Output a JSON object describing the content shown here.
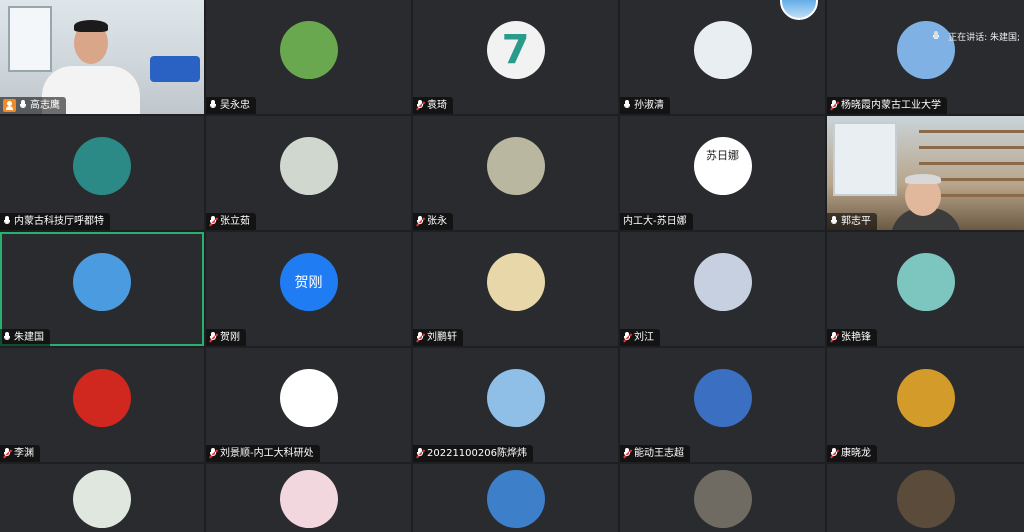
{
  "speaking": {
    "label": "正在讲话: 朱建国;"
  },
  "tiles": [
    {
      "name": "高志鹰",
      "mic": "on",
      "host": true,
      "avatar": "video-office"
    },
    {
      "name": "吴永忠",
      "mic": "on",
      "avatar": "grassland",
      "color": "#6aa84f"
    },
    {
      "name": "袁琦",
      "mic": "muted",
      "avatar": "number-seven",
      "color": "#f2f2f2"
    },
    {
      "name": "孙淑清",
      "mic": "on",
      "avatar": "blossom",
      "color": "#e9eef2"
    },
    {
      "name": "杨晓霞内蒙古工业大学",
      "mic": "muted",
      "avatar": "sky",
      "color": "#7fb1e4"
    },
    {
      "name": "内蒙古科技厅呼都特",
      "mic": "on",
      "avatar": "cartoon-girl",
      "color": "#2c8a86"
    },
    {
      "name": "张立茹",
      "mic": "muted",
      "avatar": "flowers",
      "color": "#cfd7cf"
    },
    {
      "name": "张永",
      "mic": "muted",
      "avatar": "sculpture",
      "color": "#b9b7a0"
    },
    {
      "name": "内工大-苏日娜",
      "mic": "none",
      "avatar": "sketch-girl",
      "color": "#ffffff",
      "avatar_text": "苏日娜"
    },
    {
      "name": "郭志平",
      "mic": "on",
      "avatar": "video-study"
    },
    {
      "name": "朱建国",
      "mic": "on",
      "active": true,
      "avatar": "lake",
      "color": "#4b9be0"
    },
    {
      "name": "贺刚",
      "mic": "muted",
      "avatar": "text-avatar",
      "color": "#1f7cf2",
      "avatar_text": "贺刚"
    },
    {
      "name": "刘鹏轩",
      "mic": "muted",
      "avatar": "pikachu",
      "color": "#e8d7a8"
    },
    {
      "name": "刘江",
      "mic": "muted",
      "avatar": "family-photo",
      "color": "#c7d0e0"
    },
    {
      "name": "张艳锋",
      "mic": "muted",
      "avatar": "boat",
      "color": "#7cc6bf"
    },
    {
      "name": "李渊",
      "mic": "muted",
      "avatar": "opera-cartoon",
      "color": "#d0281f"
    },
    {
      "name": "刘景顺-内工大科研处",
      "mic": "muted",
      "avatar": "university-seal",
      "color": "#ffffff"
    },
    {
      "name": "20221100206陈烨炜",
      "mic": "muted",
      "avatar": "boy-cartoon",
      "color": "#8fbfe7"
    },
    {
      "name": "能动王志超",
      "mic": "muted",
      "avatar": "blue-sphere",
      "color": "#3a6fc2"
    },
    {
      "name": "康晓龙",
      "mic": "muted",
      "avatar": "autumn-trees",
      "color": "#d29b2a"
    },
    {
      "name": "",
      "mic": "none",
      "avatar": "line-girl",
      "color": "#dfe7df"
    },
    {
      "name": "",
      "mic": "none",
      "avatar": "anime-girl",
      "color": "#f3d7df"
    },
    {
      "name": "",
      "mic": "none",
      "avatar": "wind-turbine",
      "color": "#3d7fc9"
    },
    {
      "name": "",
      "mic": "none",
      "avatar": "dark-photo",
      "color": "#6f6a62"
    },
    {
      "name": "",
      "mic": "none",
      "avatar": "smiling-man",
      "color": "#5b4b3a"
    }
  ]
}
